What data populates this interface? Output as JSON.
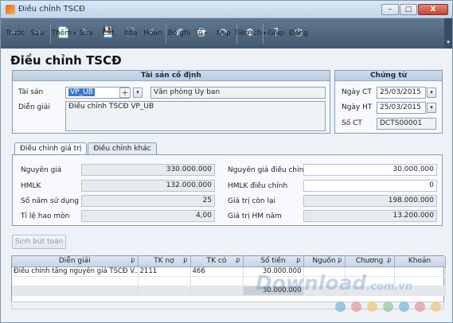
{
  "window": {
    "title": "Điều chỉnh TSCĐ",
    "btn_min": "–",
    "btn_max": "□",
    "btn_close": "X"
  },
  "toolbar": {
    "items": [
      {
        "label": "Trước",
        "icon": "←",
        "disabled": true
      },
      {
        "label": "Sau",
        "icon": "→",
        "disabled": true
      },
      {
        "label": "Thêm",
        "icon": "📄",
        "disabled": false,
        "caret": "▾"
      },
      {
        "label": "Sửa",
        "icon": "✎",
        "disabled": true
      },
      {
        "label": "Cất",
        "icon": "💾",
        "disabled": true
      },
      {
        "label": "Xóa",
        "icon": "🗋",
        "disabled": true
      },
      {
        "label": "Hoãn",
        "icon": "↶",
        "disabled": true
      },
      {
        "label": "Bỏ ghi",
        "icon": "✐",
        "disabled": false
      },
      {
        "label": "In",
        "icon": "🖶",
        "disabled": false,
        "caret": "▾"
      },
      {
        "label": "Nạp",
        "icon": "⟳",
        "disabled": false
      },
      {
        "label": "Tiện ích",
        "icon": "⚙",
        "disabled": false,
        "caret": "▾"
      },
      {
        "label": "Giúp",
        "icon": "?",
        "disabled": false
      },
      {
        "label": "Đóng",
        "icon": "⏻",
        "disabled": false
      }
    ],
    "overflow": "▾"
  },
  "page_title": "Điều chỉnh TSCĐ",
  "asset_panel": {
    "header": "Tài sản cố định",
    "asset_label": "Tài sản",
    "asset_code": "VP_UB",
    "asset_name": "Văn phòng Ủy ban",
    "desc_label": "Diễn giải",
    "desc_value": "Điều chỉnh TSCĐ VP_UB",
    "plus": "+",
    "caret": "▾"
  },
  "voucher_panel": {
    "header": "Chứng từ",
    "ngay_ct_label": "Ngày CT",
    "ngay_ct": "25/03/2015",
    "ngay_ht_label": "Ngày HT",
    "ngay_ht": "25/03/2015",
    "so_ct_label": "Số CT",
    "so_ct": "DCTS00001",
    "caret": "▾"
  },
  "tabs": [
    {
      "label": "Điều chỉnh giá trị",
      "active": true
    },
    {
      "label": "Điều chỉnh khác",
      "active": false
    }
  ],
  "values": {
    "nguyen_gia_label": "Nguyên giá",
    "nguyen_gia": "330.000.000",
    "hmlk_label": "HMLK",
    "hmlk": "132.000.000",
    "so_nam_label": "Số năm sử dụng",
    "so_nam": "25",
    "ti_le_label": "Tỉ lệ hao mòn",
    "ti_le": "4,00",
    "ng_dc_label": "Nguyên giá điều chỉnh",
    "ng_dc": "30.000.000",
    "hmlk_dc_label": "HMLK điều chỉnh",
    "hmlk_dc": "0",
    "gt_con_lai_label": "Giá trị còn lại",
    "gt_con_lai": "198.000.000",
    "gt_hm_nam_label": "Giá trị HM năm",
    "gt_hm_nam": "13.200.000"
  },
  "sinh_but_toan": "Sinh bút toán",
  "grid": {
    "columns": [
      "Diễn giải",
      "TK nợ",
      "TK có",
      "Số tiền",
      "Nguồn",
      "Chương",
      "Khoản"
    ],
    "pin": "ꝑ",
    "rows": [
      [
        "Điều chỉnh tăng nguyên giá TSCĐ V...",
        "2111",
        "466",
        "30.000.000",
        "",
        "",
        ""
      ]
    ],
    "total": "30.000.000"
  },
  "watermark": {
    "main": "Download",
    "suffix": ".com.vn"
  },
  "colors": {
    "toolbar": "#4f667d",
    "panel_border": "#7d9bb9",
    "header_bg": "#c3d3e6",
    "accent": "#3a78c9"
  }
}
